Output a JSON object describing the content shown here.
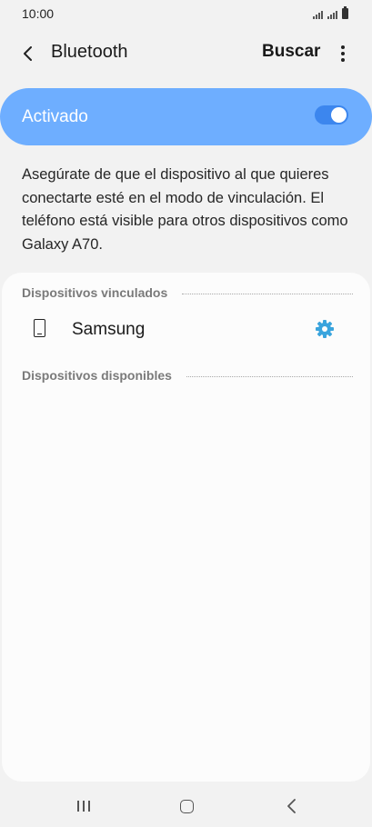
{
  "status_bar": {
    "time": "10:00"
  },
  "header": {
    "title": "Bluetooth",
    "search_label": "Buscar"
  },
  "bluetooth_toggle": {
    "label": "Activado",
    "state": "on"
  },
  "description": "Asegúrate de que el dispositivo al que quieres conectarte esté en el modo de vinculación. El teléfono está visible para otros dispositivos como Galaxy A70.",
  "paired_section": {
    "title": "Dispositivos vinculados",
    "devices": [
      {
        "name": "Samsung",
        "icon": "phone-icon",
        "action_icon": "gear-icon"
      }
    ]
  },
  "available_section": {
    "title": "Dispositivos disponibles"
  },
  "colors": {
    "toggle_card": "#6eaeff",
    "switch_track": "#3c86ee",
    "gear_icon": "#3aa4dd",
    "background": "#f2f2f2",
    "card": "#fcfcfc"
  }
}
